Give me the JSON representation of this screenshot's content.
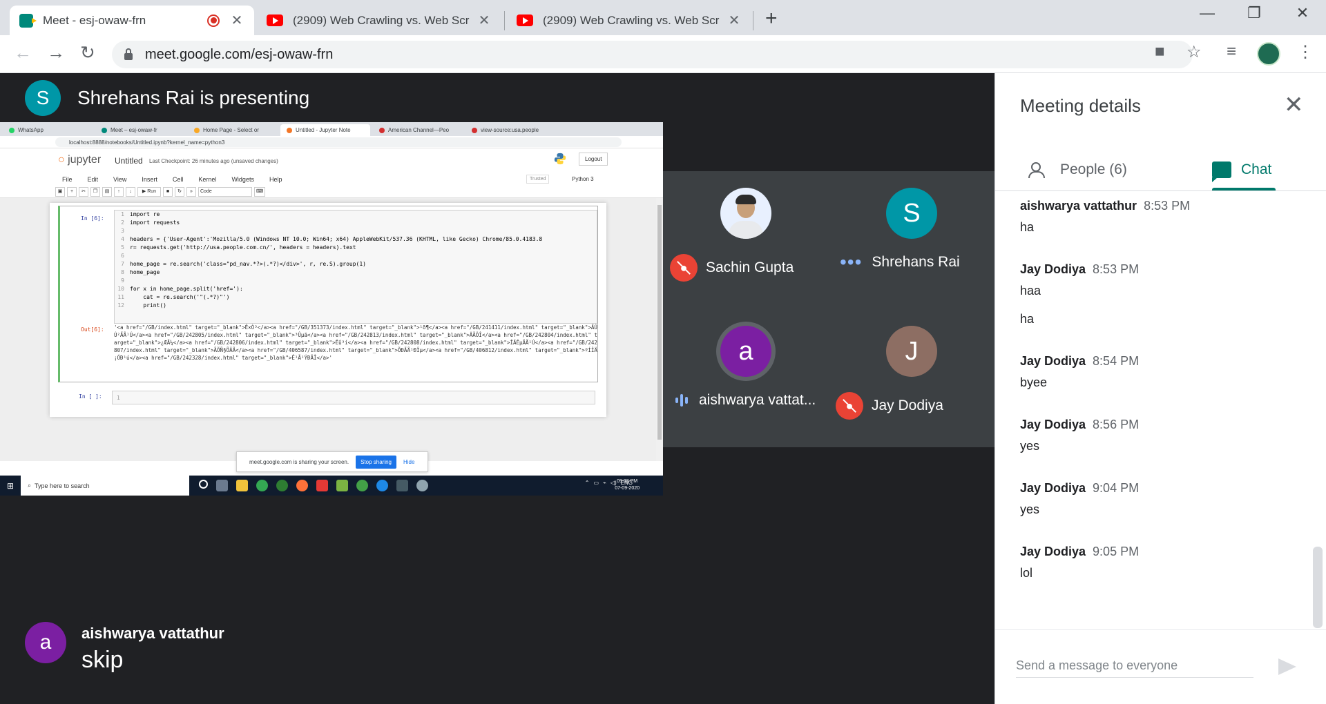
{
  "browser": {
    "tabs": [
      {
        "title": "Meet - esj-owaw-frn",
        "icon": "meet-icon",
        "recording": true,
        "active": true
      },
      {
        "title": "(2909) Web Crawling vs. Web Scr",
        "icon": "youtube-icon",
        "active": false
      },
      {
        "title": "(2909) Web Crawling vs. Web Scr",
        "icon": "youtube-icon",
        "active": false
      }
    ],
    "url": "meet.google.com/esj-owaw-frn"
  },
  "presenter": {
    "initial": "S",
    "text": "Shrehans Rai is presenting",
    "color": "#0097a7"
  },
  "screen": {
    "tabs": [
      "WhatsApp",
      "Meet – esj-owaw-fr",
      "Home Page - Select or",
      "Untitled - Jupyter Note",
      "American Channel—Peo",
      "view-source:usa.people"
    ],
    "url": "localhost:8888/notebooks/Untitled.ipynb?kernel_name=python3",
    "jupyter": {
      "logo": "jupyter",
      "title": "Untitled",
      "checkpoint": "Last Checkpoint: 26 minutes ago  (unsaved changes)",
      "logout": "Logout",
      "menu": [
        "File",
        "Edit",
        "View",
        "Insert",
        "Cell",
        "Kernel",
        "Widgets",
        "Help"
      ],
      "trusted": "Trusted",
      "kernel": "Python 3",
      "run_label": "Run",
      "cell_type": "Code",
      "prompt_in": "In [6]:",
      "prompt_out": "Out[6]:",
      "prompt_empty": "In [ ]:",
      "code_lines": [
        "import re",
        "import requests",
        "",
        "headers = {'User-Agent':'Mozilla/5.0 (Windows NT 10.0; Win64; x64) AppleWebKit/537.36 (KHTML, like Gecko) Chrome/85.0.4183.8",
        "r= requests.get('http://usa.people.com.cn/', headers = headers).text",
        "",
        "home_page = re.search('class=\"pd_nav.*?>(.*?)</div>', r, re.S).group(1)",
        "home_page",
        "",
        "for x in home_page.split('href='):",
        "    cat = re.search('\"(.*?)\"')",
        "    print()"
      ],
      "output": "'<a href=\"/GB/index.html\" target=\"_blank\">Ê×Ò³</a><a href=\"/GB/351373/index.html\" target=\"_blank\">¹ð¶</a><a href=\"/GB/241411/index.html\" target=\"_blank\">ÃÛÚ²ÃÃ¹Ú</a><a href=\"/GB/242805/index.html\" target=\"_blank\">³Ûµã</a><a href=\"/GB/242813/index.html\" target=\"_blank\">ÄÃÔÎ</a><a href=\"/GB/242804/index.html\" target=\"_blank\">¿ÆÃ¼</a><a href=\"/GB/242806/index.html\" target=\"_blank\">Ëû³í</a><a href=\"/GB/242808/index.html\" target=\"_blank\">ÎÄÊµÃÃ¹Ú</a><a href=\"/GB/242807/index.html\" target=\"_blank\">ÃÕÑ§ÕÂÃ</a><a href=\"/GB/406587/index.html\" target=\"_blank\">ÕÐÃÃ¹ÐÎµ</a><a href=\"/GB/406812/index.html\" target=\"_blank\">ºÍÎÄ¡ÓÐ¹ú</a><a href=\"/GB/242328/index.html\" target=\"_blank\">Ê¹Ã¹ÝÐÃÎ</a>'",
      "empty_line_no": "1"
    },
    "share_bar": {
      "text": "meet.google.com is sharing your screen.",
      "stop": "Stop sharing",
      "hide": "Hide"
    },
    "taskbar": {
      "search": "Type here to search",
      "lang": "ENG",
      "time": "09:08 PM",
      "date": "07-09-2020"
    }
  },
  "participants": [
    {
      "name": "Sachin Gupta",
      "type": "photo",
      "status": "muted"
    },
    {
      "name": "Shrehans Rai",
      "initial": "S",
      "color": "#0097a7",
      "status": "more"
    },
    {
      "name": "aishwarya vattat...",
      "initial": "a",
      "color": "#7b1fa2",
      "status": "speaking"
    },
    {
      "name": "Jay Dodiya",
      "initial": "J",
      "color": "#8d6e63",
      "status": "muted"
    }
  ],
  "caption": {
    "initial": "a",
    "color": "#7b1fa2",
    "name": "aishwarya vattathur",
    "text": "skip"
  },
  "panel": {
    "title": "Meeting details",
    "people_tab": "People (6)",
    "chat_tab": "Chat",
    "messages": [
      {
        "sender": "aishwarya vattathur",
        "time": "8:53 PM",
        "texts": [
          "ha"
        ]
      },
      {
        "sender": "Jay Dodiya",
        "time": "8:53 PM",
        "texts": [
          "haa",
          "ha"
        ]
      },
      {
        "sender": "Jay Dodiya",
        "time": "8:54 PM",
        "texts": [
          "byee"
        ]
      },
      {
        "sender": "Jay Dodiya",
        "time": "8:56 PM",
        "texts": [
          "yes"
        ]
      },
      {
        "sender": "Jay Dodiya",
        "time": "9:04 PM",
        "texts": [
          "yes"
        ]
      },
      {
        "sender": "Jay Dodiya",
        "time": "9:05 PM",
        "texts": [
          "lol"
        ]
      }
    ],
    "compose_placeholder": "Send a message to everyone"
  }
}
